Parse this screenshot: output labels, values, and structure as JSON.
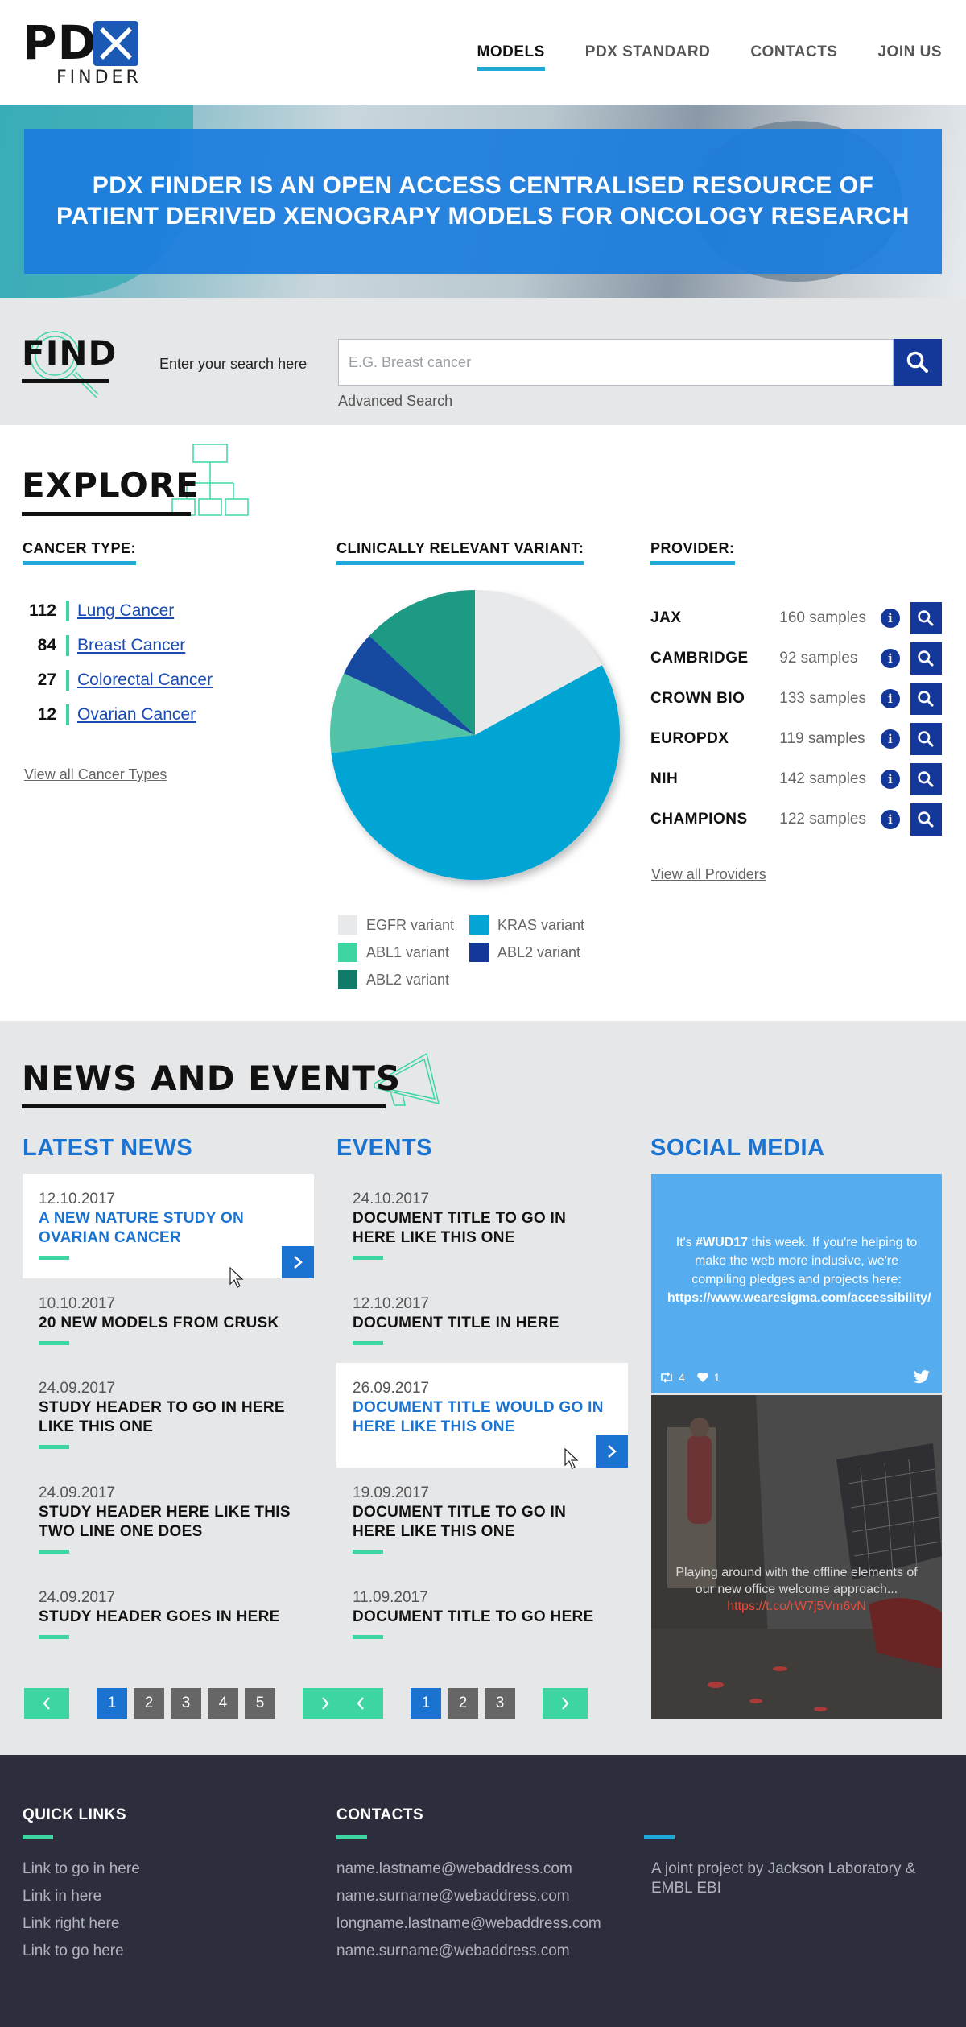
{
  "header": {
    "logo": {
      "pd": "PD",
      "x": "X",
      "finder": "FINDER"
    },
    "nav": [
      {
        "label": "MODELS",
        "active": true
      },
      {
        "label": "PDX STANDARD",
        "active": false
      },
      {
        "label": "CONTACTS",
        "active": false
      },
      {
        "label": "JOIN US",
        "active": false
      }
    ]
  },
  "hero": {
    "line1": "PDX FINDER IS AN OPEN ACCESS CENTRALISED RESOURCE OF",
    "line2": "PATIENT DERIVED XENOGRAPY MODELS FOR ONCOLOGY RESEARCH"
  },
  "find": {
    "heading": "FIND",
    "label": "Enter your search here",
    "placeholder": "E.G. Breast cancer",
    "advanced": "Advanced Search"
  },
  "explore": {
    "heading": "EXPLORE",
    "cancer_type": {
      "heading": "CANCER TYPE:",
      "items": [
        {
          "count": "112",
          "label": "Lung Cancer"
        },
        {
          "count": "84",
          "label": "Breast Cancer"
        },
        {
          "count": "27",
          "label": "Colorectal Cancer"
        },
        {
          "count": "12",
          "label": "Ovarian Cancer"
        }
      ],
      "view_all": "View all Cancer Types"
    },
    "variant": {
      "heading": "CLINICALLY RELEVANT VARIANT:"
    },
    "provider": {
      "heading": "PROVIDER:",
      "items": [
        {
          "name": "JAX",
          "samples": "160 samples"
        },
        {
          "name": "CAMBRIDGE",
          "samples": "92 samples"
        },
        {
          "name": "CROWN BIO",
          "samples": "133 samples"
        },
        {
          "name": "EUROPDX",
          "samples": "119 samples"
        },
        {
          "name": "NIH",
          "samples": "142 samples"
        },
        {
          "name": "CHAMPIONS",
          "samples": "122 samples"
        }
      ],
      "view_all": "View all Providers"
    }
  },
  "chart_data": {
    "type": "pie",
    "title": "",
    "slices": [
      {
        "label": "EGFR variant",
        "value": 17,
        "color": "#e8e9ea"
      },
      {
        "label": "KRAS variant",
        "value": 56,
        "color": "#04a5d4"
      },
      {
        "label": "ABL1 variant",
        "value": 9,
        "color": "#52c3a8"
      },
      {
        "label": "ABL2 variant",
        "value": 5,
        "color": "#1549a0"
      },
      {
        "label": "ABL2 variant",
        "value": 13,
        "color": "#1e9a84"
      }
    ],
    "legend": [
      {
        "label": "EGFR variant",
        "color": "#e8e9ea"
      },
      {
        "label": "KRAS variant",
        "color": "#04a5d4"
      },
      {
        "label": "ABL1 variant",
        "color": "#3dd6a3"
      },
      {
        "label": "ABL2 variant",
        "color": "#14389a"
      },
      {
        "label": "ABL2 variant",
        "color": "#127a6a"
      }
    ]
  },
  "news": {
    "heading": "NEWS AND EVENTS",
    "latest": {
      "heading": "LATEST NEWS",
      "items": [
        {
          "date": "12.10.2017",
          "title": "A NEW NATURE STUDY ON OVARIAN CANCER",
          "highlight": true
        },
        {
          "date": "10.10.2017",
          "title": "20 NEW MODELS FROM CRUSK",
          "highlight": false
        },
        {
          "date": "24.09.2017",
          "title": "STUDY HEADER TO GO IN HERE LIKE THIS ONE",
          "highlight": false
        },
        {
          "date": "24.09.2017",
          "title": "STUDY HEADER HERE LIKE THIS TWO LINE ONE DOES",
          "highlight": false
        },
        {
          "date": "24.09.2017",
          "title": "STUDY HEADER GOES IN HERE",
          "highlight": false
        }
      ],
      "pages": [
        "1",
        "2",
        "3",
        "4",
        "5"
      ]
    },
    "events": {
      "heading": "EVENTS",
      "items": [
        {
          "date": "24.10.2017",
          "title": "DOCUMENT TITLE TO GO IN HERE LIKE THIS ONE",
          "highlight": false
        },
        {
          "date": "12.10.2017",
          "title": "DOCUMENT TITLE IN HERE",
          "highlight": false
        },
        {
          "date": "26.09.2017",
          "title": "DOCUMENT TITLE WOULD GO IN HERE LIKE THIS ONE",
          "highlight": true
        },
        {
          "date": "19.09.2017",
          "title": "DOCUMENT TITLE TO GO IN HERE LIKE THIS ONE",
          "highlight": false
        },
        {
          "date": "11.09.2017",
          "title": "DOCUMENT TITLE TO GO HERE",
          "highlight": false
        }
      ],
      "pages": [
        "1",
        "2",
        "3"
      ]
    },
    "social": {
      "heading": "SOCIAL MEDIA",
      "tweet": {
        "pre": "It's ",
        "hashtag": "#WUD17",
        "mid": " this week. If you're helping to make the web more inclusive, we're compiling pledges and projects here: ",
        "link": "https://www.wearesigma.com/accessibility/",
        "retweets": "4",
        "likes": "1"
      },
      "photo": {
        "text": "Playing around with the offline elements of our new office welcome approach...",
        "link": "https://t.co/rW7j5Vm6vN"
      }
    }
  },
  "footer": {
    "quick_links": {
      "heading": "QUICK LINKS",
      "items": [
        "Link to go in here",
        "Link in here",
        "Link right here",
        "Link to go here"
      ]
    },
    "contacts": {
      "heading": "CONTACTS",
      "items": [
        "name.lastname@webaddress.com",
        "name.surname@webaddress.com",
        "longname.lastname@webaddress.com",
        "name.surname@webaddress.com"
      ]
    },
    "about": "A joint project by Jackson Laboratory & EMBL EBI"
  },
  "colors": {
    "accent": "#1ea9d9",
    "brand": "#14389a",
    "green": "#3dd6a3",
    "news_blue": "#1a73d1",
    "footer": "#2d2e3d"
  }
}
